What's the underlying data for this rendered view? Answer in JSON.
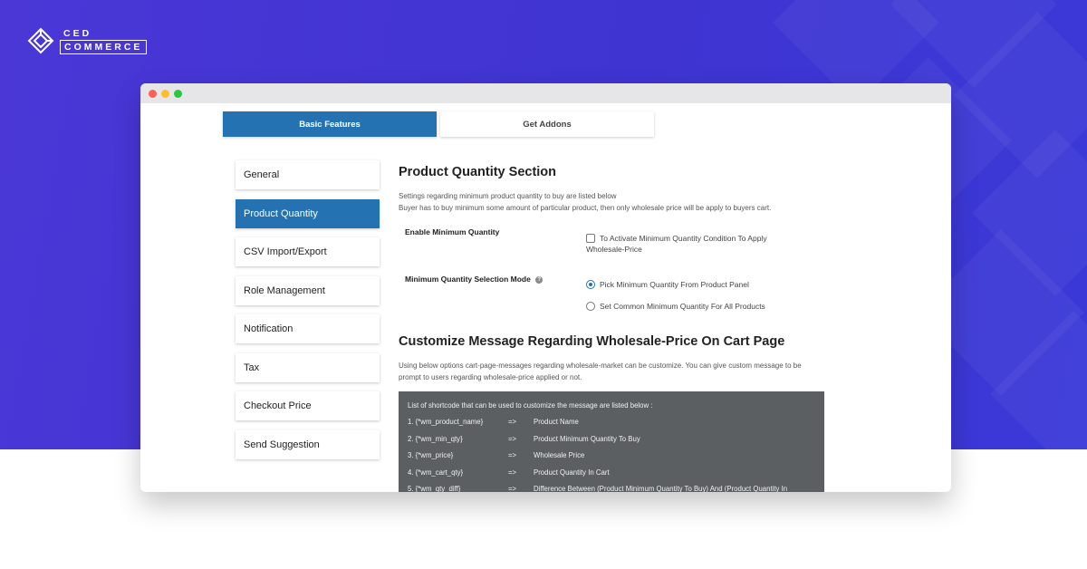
{
  "brand": {
    "logo_top": "CED",
    "logo_bottom": "COMMERCE",
    "icon": "cedcommerce-diamond-icon"
  },
  "colors": {
    "hero_background": "#4136d4",
    "accent": "#2572b2",
    "shortcode_panel": "#5b5f62",
    "traffic_red": "#fe5f57",
    "traffic_yellow": "#febc2e",
    "traffic_green": "#28c840"
  },
  "tabs": [
    {
      "label": "Basic Features",
      "active": true
    },
    {
      "label": "Get Addons",
      "active": false
    }
  ],
  "sidebar": {
    "items": [
      {
        "label": "General",
        "active": false
      },
      {
        "label": "Product Quantity",
        "active": true
      },
      {
        "label": "CSV Import/Export",
        "active": false
      },
      {
        "label": "Role Management",
        "active": false
      },
      {
        "label": "Notification",
        "active": false
      },
      {
        "label": "Tax",
        "active": false
      },
      {
        "label": "Checkout Price",
        "active": false
      },
      {
        "label": "Send Suggestion",
        "active": false
      }
    ]
  },
  "section1": {
    "title": "Product Quantity Section",
    "desc_line1": "Settings regarding minimum product quantity to buy are listed below",
    "desc_line2": "Buyer has to buy minimum some amount of particular product, then only wholesale price will be apply to buyers cart.",
    "enable_label": "Enable Minimum Quantity",
    "enable_option_line1": "To Activate Minimum Quantity Condition To Apply",
    "enable_option_line2": "Wholesale-Price",
    "enable_checked": false,
    "mode_label": "Minimum Quantity Selection Mode",
    "mode_help_icon": "question-help-icon",
    "mode_options": [
      {
        "label": "Pick Minimum Quantity From Product Panel",
        "checked": true
      },
      {
        "label": "Set Common Minimum Quantity For All Products",
        "checked": false
      }
    ]
  },
  "section2": {
    "title": "Customize Message Regarding Wholesale-Price On Cart Page",
    "desc_line1": "Using below options cart-page-messages regarding wholesale-market can be customize. You can give custom message to be",
    "desc_line2": "prompt to users regarding wholesale-price applied or not.",
    "shortcode_intro": "List of shortcode that can be used to customize the message are listed below :",
    "shortcodes": [
      {
        "code": "1. {*wm_product_name}",
        "arrow": "=>",
        "meaning": "Product Name"
      },
      {
        "code": "2. {*wm_min_qty}",
        "arrow": "=>",
        "meaning": "Product Minimum Quantity To Buy"
      },
      {
        "code": "3. {*wm_price}",
        "arrow": "=>",
        "meaning": "Wholesale Price"
      },
      {
        "code": "4. {*wm_cart_qty}",
        "arrow": "=>",
        "meaning": "Product Quantity In Cart"
      },
      {
        "code": "5. {*wm_qty_diff}",
        "arrow": "=>",
        "meaning": "Difference Between (Product Minimum Quantity To Buy) And (Product Quantity In"
      }
    ]
  }
}
